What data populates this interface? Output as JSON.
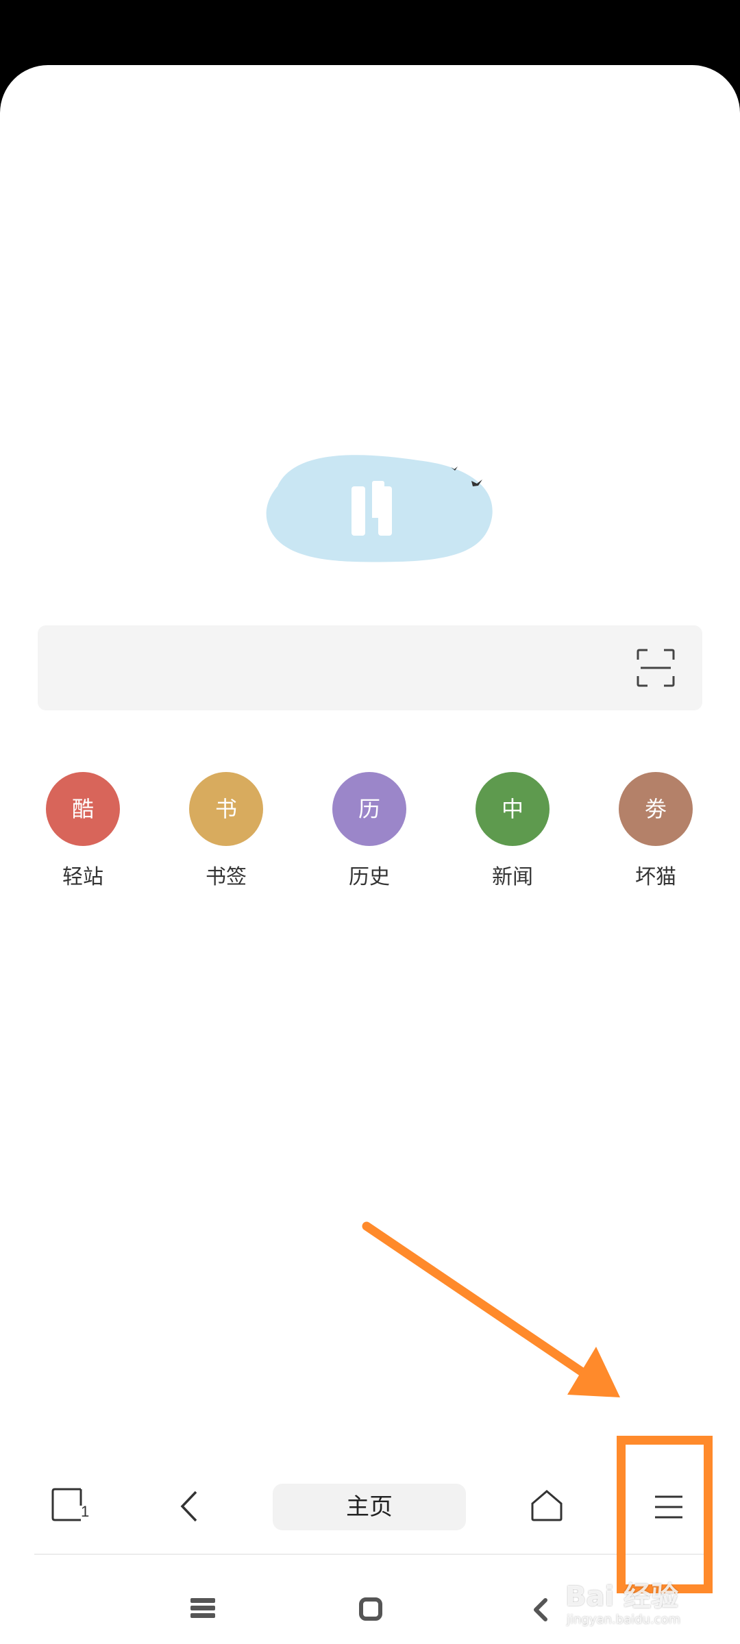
{
  "search": {
    "placeholder": "",
    "scan_icon": "scan-icon"
  },
  "shortcuts": [
    {
      "icon_text": "酷",
      "label": "轻站",
      "color": "#d8655a"
    },
    {
      "icon_text": "书",
      "label": "书签",
      "color": "#d8ab5e"
    },
    {
      "icon_text": "历",
      "label": "历史",
      "color": "#9b86c9"
    },
    {
      "icon_text": "中",
      "label": "新闻",
      "color": "#5e9a4e"
    },
    {
      "icon_text": "劵",
      "label": "坏猫",
      "color": "#b48169"
    }
  ],
  "toolbar": {
    "tab_count": "1",
    "home_label": "主页",
    "icons": [
      "tabs-icon",
      "back-arrow-icon",
      "home-icon",
      "menu-icon"
    ]
  },
  "navbar": {
    "icons": [
      "recent-apps-icon",
      "home-square-icon",
      "back-icon"
    ]
  },
  "watermark": {
    "main": "Bai 经验",
    "sub": "jingyan.baidu.com"
  },
  "colors": {
    "annotation": "#ff8a2b",
    "logo_blob": "#c9e6f3"
  }
}
